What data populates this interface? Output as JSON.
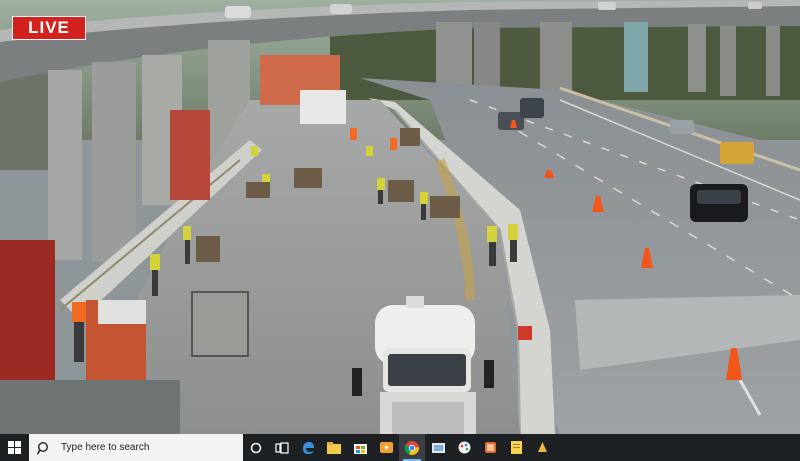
{
  "overlay": {
    "live_label": "LIVE"
  },
  "taskbar": {
    "search_placeholder": "Type here to search",
    "apps": [
      {
        "name": "cortana-icon"
      },
      {
        "name": "task-view-icon"
      },
      {
        "name": "edge-icon"
      },
      {
        "name": "file-explorer-icon"
      },
      {
        "name": "store-icon"
      },
      {
        "name": "media-app-icon"
      },
      {
        "name": "chrome-icon",
        "active": true
      },
      {
        "name": "photos-icon"
      },
      {
        "name": "paint-icon"
      },
      {
        "name": "snip-icon"
      },
      {
        "name": "notes-icon"
      },
      {
        "name": "app-icon"
      }
    ]
  },
  "colors": {
    "live_badge": "#d3211d",
    "taskbar": "#1e2124",
    "search_box": "#f3f3f3"
  }
}
